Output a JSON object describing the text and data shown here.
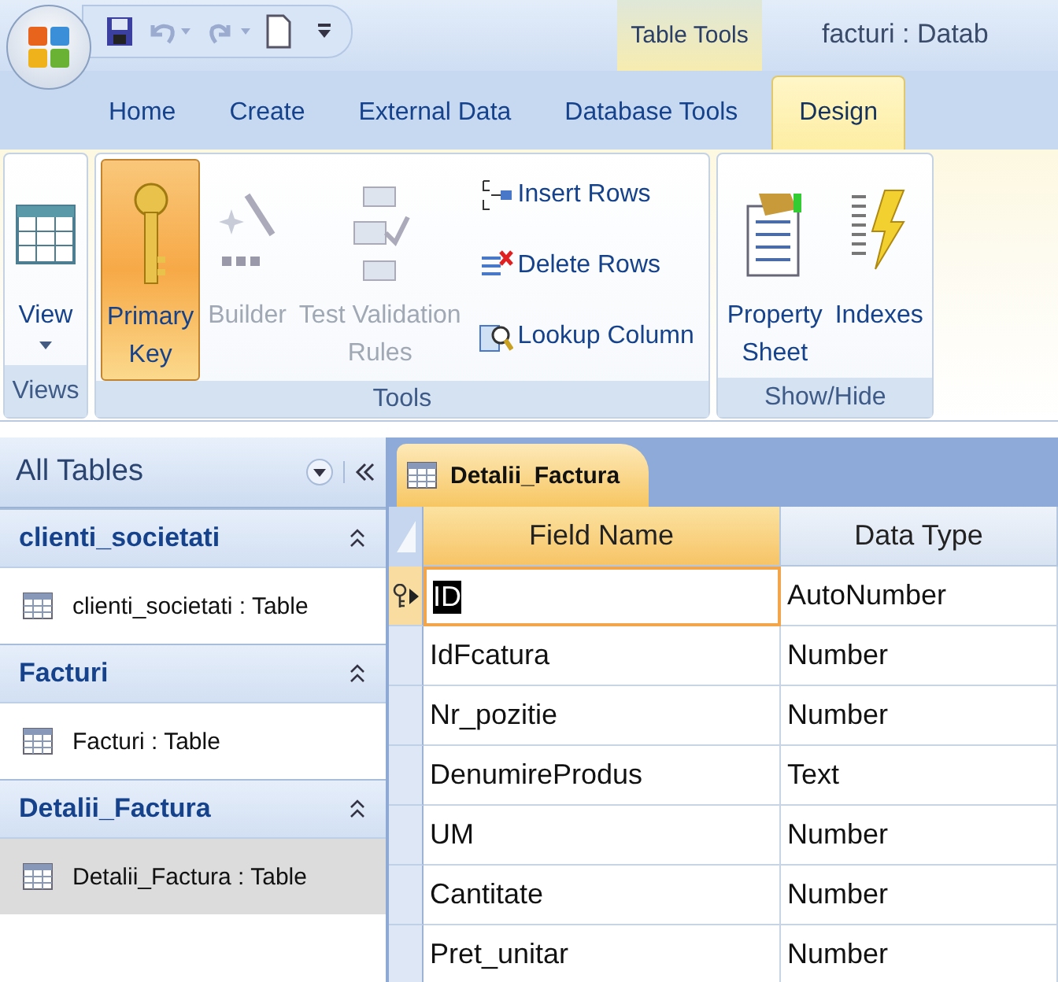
{
  "window": {
    "title": "facturi : Datab",
    "contextual_tab": "Table Tools"
  },
  "tabs": [
    {
      "label": "Home",
      "selected": false
    },
    {
      "label": "Create",
      "selected": false
    },
    {
      "label": "External Data",
      "selected": false
    },
    {
      "label": "Database Tools",
      "selected": false
    },
    {
      "label": "Design",
      "selected": true
    }
  ],
  "ribbon": {
    "groups": [
      {
        "label": "Views",
        "buttons": [
          {
            "kind": "view",
            "lines": [
              "View"
            ],
            "dropdown": true,
            "pressed": false,
            "disabled": false
          }
        ]
      },
      {
        "label": "Tools",
        "buttons": [
          {
            "kind": "key",
            "lines": [
              "Primary",
              "Key"
            ],
            "pressed": true,
            "disabled": false
          },
          {
            "kind": "builder",
            "lines": [
              "Builder"
            ],
            "pressed": false,
            "disabled": true
          },
          {
            "kind": "validation",
            "lines": [
              "Test Validation",
              "Rules"
            ],
            "pressed": false,
            "disabled": true
          }
        ],
        "small_buttons": [
          {
            "kind": "insert",
            "label": "Insert Rows"
          },
          {
            "kind": "delete",
            "label": "Delete Rows"
          },
          {
            "kind": "lookup",
            "label": "Lookup Column"
          }
        ]
      },
      {
        "label": "Show/Hide",
        "buttons": [
          {
            "kind": "property",
            "lines": [
              "Property",
              "Sheet"
            ],
            "pressed": false,
            "disabled": false
          },
          {
            "kind": "indexes",
            "lines": [
              "Indexes"
            ],
            "pressed": false,
            "disabled": false
          }
        ]
      }
    ]
  },
  "nav_pane": {
    "title": "All Tables",
    "groups": [
      {
        "title": "clienti_societati",
        "expanded": true,
        "items": [
          {
            "label": "clienti_societati : Table",
            "selected": false
          }
        ]
      },
      {
        "title": "Facturi",
        "expanded": true,
        "items": [
          {
            "label": "Facturi : Table",
            "selected": false
          }
        ]
      },
      {
        "title": "Detalii_Factura",
        "expanded": true,
        "items": [
          {
            "label": "Detalii_Factura : Table",
            "selected": true
          }
        ]
      }
    ]
  },
  "document_tab": {
    "label": "Detalii_Factura",
    "selected": true
  },
  "table": {
    "columns": [
      {
        "label": "Field Name",
        "selected": true
      },
      {
        "label": "Data Type",
        "selected": false
      }
    ],
    "rows": [
      {
        "field": "ID",
        "type": "AutoNumber",
        "primary_key": true,
        "selected": true
      },
      {
        "field": "IdFcatura",
        "type": "Number",
        "primary_key": false,
        "selected": false
      },
      {
        "field": "Nr_pozitie",
        "type": "Number",
        "primary_key": false,
        "selected": false
      },
      {
        "field": "DenumireProdus",
        "type": "Text",
        "primary_key": false,
        "selected": false
      },
      {
        "field": "UM",
        "type": "Number",
        "primary_key": false,
        "selected": false
      },
      {
        "field": "Cantitate",
        "type": "Number",
        "primary_key": false,
        "selected": false
      },
      {
        "field": "Pret_unitar",
        "type": "Number",
        "primary_key": false,
        "selected": false
      }
    ]
  }
}
